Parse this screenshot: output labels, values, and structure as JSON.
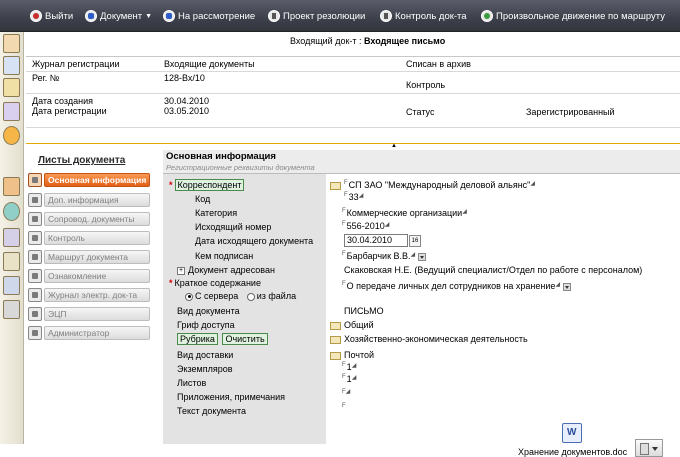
{
  "toolbar": {
    "exit": "Выйти",
    "document": "Документ",
    "review": "На рассмотрение",
    "draft_resolution": "Проект резолюции",
    "control": "Контроль док-та",
    "route": "Произвольное движение по маршруту"
  },
  "header": {
    "title_prefix": "Входящий док-т :",
    "title_value": "Входящее письмо",
    "journal_label": "Журнал регистрации",
    "journal_value": "Входящие документы",
    "archive_label": "Списан в архив",
    "reg_label": "Рег. №",
    "reg_value": "128-Вх/10",
    "control_label": "Контроль",
    "created_label": "Дата создания",
    "created_value": "30.04.2010",
    "registered_label": "Дата регистрации",
    "registered_value": "03.05.2010",
    "status_label": "Статус",
    "status_value": "Зарегистрированный"
  },
  "left_panel": {
    "title": "Листы документа",
    "items": [
      {
        "label": "Основная информация",
        "active": true
      },
      {
        "label": "Доп. информация"
      },
      {
        "label": "Сопровод. документы"
      },
      {
        "label": "Контроль"
      },
      {
        "label": "Маршрут документа"
      },
      {
        "label": "Ознакомление"
      },
      {
        "label": "Журнал электр. док-та"
      },
      {
        "label": "ЭЦП"
      },
      {
        "label": "Администратор"
      }
    ]
  },
  "main": {
    "title": "Основная информация",
    "subtitle": "Регистрационные реквизиты документа",
    "fields": {
      "correspondent_label": "Корреспондент",
      "correspondent_value": "СП ЗАО \"Международный деловой альянс\"",
      "code_label": "Код",
      "code_value": "33",
      "category_label": "Категория",
      "category_value": "Коммерческие организации",
      "out_number_label": "Исходящий номер",
      "out_number_value": "556-2010",
      "out_date_label": "Дата исходящего документа",
      "out_date_value": "30.04.2010",
      "signed_label": "Кем подписан",
      "signed_value": "Барбарчик В.В.",
      "addressed_label": "Документ адресован",
      "addressed_value": "Скаковская Н.Е. (Ведущий специалист/Отдел по работе с персоналом)",
      "summary_label": "Краткое содержание",
      "summary_value": "О передаче личных дел сотрудников на хранение",
      "from_server": "С сервера",
      "from_file": "из файла",
      "doctype_label": "Вид документа",
      "doctype_value": "ПИСЬМО",
      "access_label": "Гриф доступа",
      "access_value": "Общий",
      "rubric_label": "Рубрика",
      "clear_label": "Очистить",
      "rubric_value": "Хозяйственно-экономическая деятельность",
      "delivery_label": "Вид доставки",
      "delivery_value": "Почтой",
      "copies_label": "Экземпляров",
      "copies_value": "1",
      "sheets_label": "Листов",
      "sheets_value": "1",
      "attachments_label": "Приложения, примечания",
      "text_label": "Текст документа",
      "file_name": "Хранение документов.doc",
      "calendar_day": "16"
    }
  }
}
